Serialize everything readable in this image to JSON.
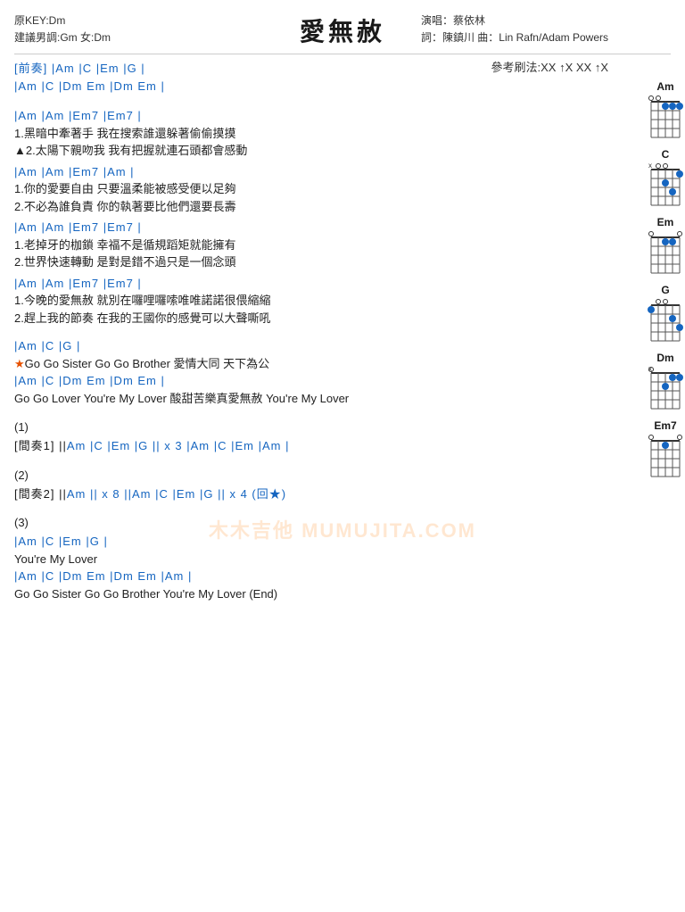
{
  "title": "愛無赦",
  "meta": {
    "original_key": "原KEY:Dm",
    "suggested_key": "建議男調:Gm 女:Dm",
    "artist_label": "演唱：蔡依林",
    "words_music": "詞：陳鎮川  曲：Lin Rafn/Adam Powers"
  },
  "strum": "參考刷法:XX ↑X XX ↑X",
  "chords_shown": [
    "Am",
    "C",
    "Em",
    "G",
    "Dm",
    "Em7"
  ],
  "intro_line1": "[前奏]  |Am       |C      |Em    |G     |",
  "intro_line2": "           |Am       |C      |Dm  Em  |Dm  Em  |",
  "section1": {
    "chord_line1": "|Am           |Am              |Em7               |Em7      |",
    "lyrics": [
      "1.黑暗中牽著手   我在搜索誰還躲著偷偷摸摸",
      "▲2.太陽下親吻我   我有把握就連石頭都會感動"
    ]
  },
  "section2": {
    "chord_line": "|Am           |Am              |Em7               |Am       |",
    "lyrics": [
      "1.你的愛要自由   只要溫柔能被感受便以足夠",
      "2.不必為誰負責   你的執著要比他們還要長壽"
    ]
  },
  "section3": {
    "chord_line": "     |Am      |Am           |Em7            |Em7      |",
    "lyrics": [
      "1.老掉牙的枷鎖   幸福不是循規蹈矩就能擁有",
      "2.世界快速轉動   是對是錯不過只是一個念頭"
    ]
  },
  "section4": {
    "chord_line": "   |Am       |Am           |Em7              |Em7      |",
    "lyrics": [
      "1.今晚的愛無赦   就別在囉哩囉嗦唯唯諾諾很偎縮縮",
      "2.趕上我的節奏   在我的王國你的感覺可以大聲嘶吼"
    ]
  },
  "chorus": {
    "chord_line1": "         |Am               |C              |G      |",
    "line1": "★Go Go Sister    Go Go Brother    愛情大同      天下為公",
    "chord_line2": "         |Am                         |C      |Dm  Em  |Dm  Em     |",
    "line2": "  Go Go Lover     You're My Lover    酸甜苦樂真愛無赦    You're My Lover"
  },
  "interlude1": {
    "label": "(1)",
    "line": "[間奏1] ||Am   |C   |Em    |G   || x 3   |Am   |C   |Em   |Am   |"
  },
  "interlude2": {
    "label": "(2)",
    "line": "[間奏2] ||Am     || x 8 ||Am   |C    |Em    |G    || x 4 (回★)"
  },
  "section_end": {
    "label": "(3)",
    "chord_line1": "          |Am    |C   |Em    |G    |",
    "line1": "You're My Lover",
    "chord_line2": "          |Am               |C              |Dm  Em  |Dm  Em   |Am   |",
    "line2": "Go Go Sister    Go Go Brother    You're My Lover                   (End)"
  },
  "watermark": "木木吉他 MUMUJITA.COM"
}
